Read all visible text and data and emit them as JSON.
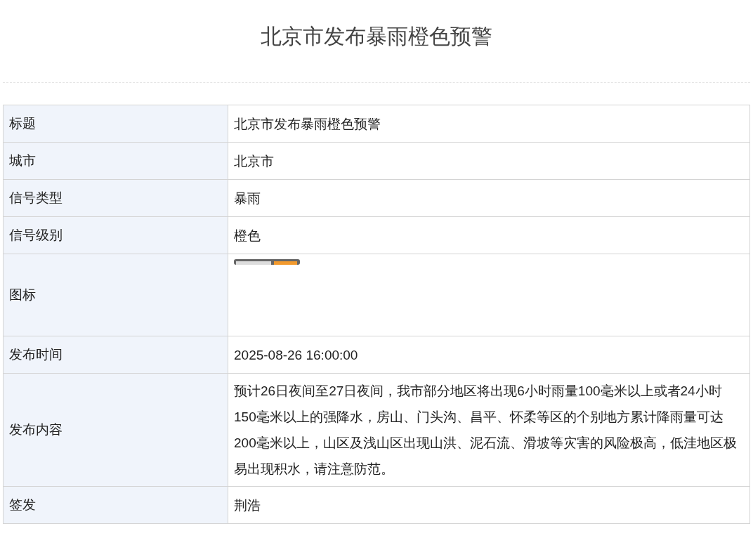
{
  "title": "北京市发布暴雨橙色预警",
  "rows": [
    {
      "kind": "text",
      "label": "标题",
      "value": "北京市发布暴雨橙色预警"
    },
    {
      "kind": "text",
      "label": "城市",
      "value": "北京市"
    },
    {
      "kind": "text",
      "label": "信号类型",
      "value": "暴雨"
    },
    {
      "kind": "text",
      "label": "信号级别",
      "value": "橙色"
    },
    {
      "kind": "icon",
      "label": "图标"
    },
    {
      "kind": "text",
      "label": "发布时间",
      "value": "2025-08-26 16:00:00"
    },
    {
      "kind": "text",
      "label": "发布内容",
      "value": "预计26日夜间至27日夜间，我市部分地区将出现6小时雨量100毫米以上或者24小时150毫米以上的强降水，房山、门头沟、昌平、怀柔等区的个别地方累计降雨量可达200毫米以上，山区及浅山区出现山洪、泥石流、滑坡等灾害的风险极高，低洼地区极易出现积水，请注意防范。"
    },
    {
      "kind": "text",
      "label": "签发",
      "value": "荆浩"
    }
  ]
}
